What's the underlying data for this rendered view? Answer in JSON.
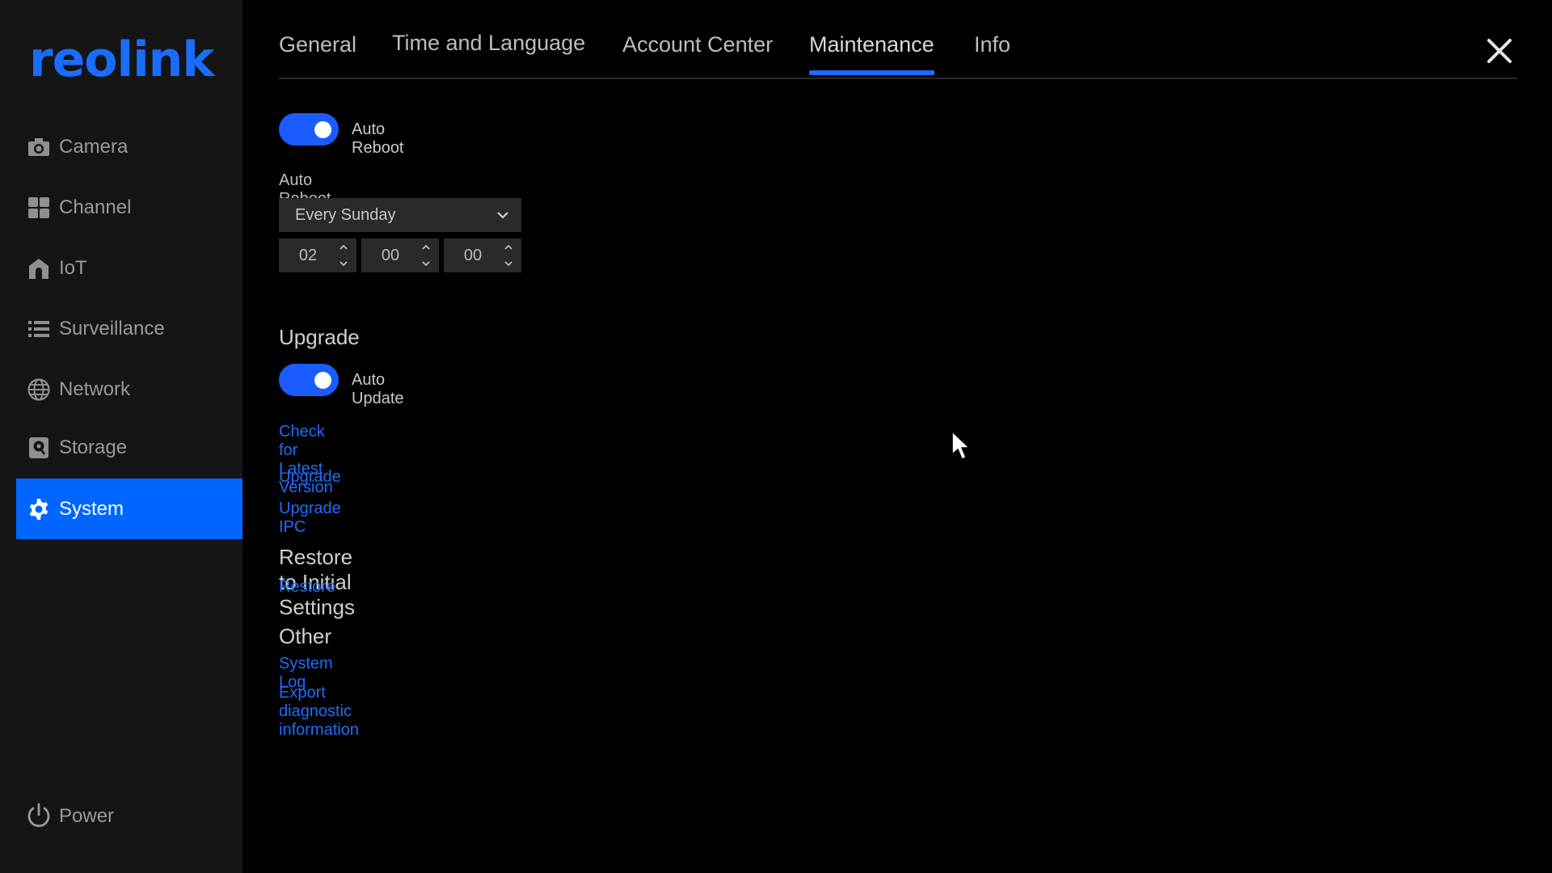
{
  "app": {
    "logo_text": "reolink",
    "accent_color": "#0066ff"
  },
  "sidebar": {
    "items": [
      {
        "label": "Camera",
        "icon": "camera-icon"
      },
      {
        "label": "Channel",
        "icon": "grid-icon"
      },
      {
        "label": "IoT",
        "icon": "home-icon"
      },
      {
        "label": "Surveillance",
        "icon": "list-icon"
      },
      {
        "label": "Network",
        "icon": "globe-icon"
      },
      {
        "label": "Storage",
        "icon": "storage-icon"
      },
      {
        "label": "System",
        "icon": "gear-icon",
        "active": true
      }
    ],
    "power_label": "Power"
  },
  "tabs": [
    {
      "label": "General"
    },
    {
      "label": "Time and Language"
    },
    {
      "label": "Account Center"
    },
    {
      "label": "Maintenance",
      "active": true
    },
    {
      "label": "Info"
    }
  ],
  "maintenance": {
    "auto_reboot_label": "Auto Reboot",
    "auto_reboot_on": true,
    "auto_reboot_time_label": "Auto Reboot Time",
    "schedule_value": "Every Sunday",
    "time": {
      "hour": "02",
      "minute": "00",
      "second": "00"
    },
    "upgrade_title": "Upgrade",
    "auto_update_label": "Auto Update",
    "auto_update_on": true,
    "check_latest_label": "Check for Latest Version",
    "upgrade_link": "Upgrade",
    "upgrade_ipc_link": "Upgrade IPC",
    "restore_title": "Restore to Initial Settings",
    "restore_link": "Restore",
    "other_title": "Other",
    "system_log_link": "System Log",
    "export_diag_link": "Export diagnostic information"
  }
}
